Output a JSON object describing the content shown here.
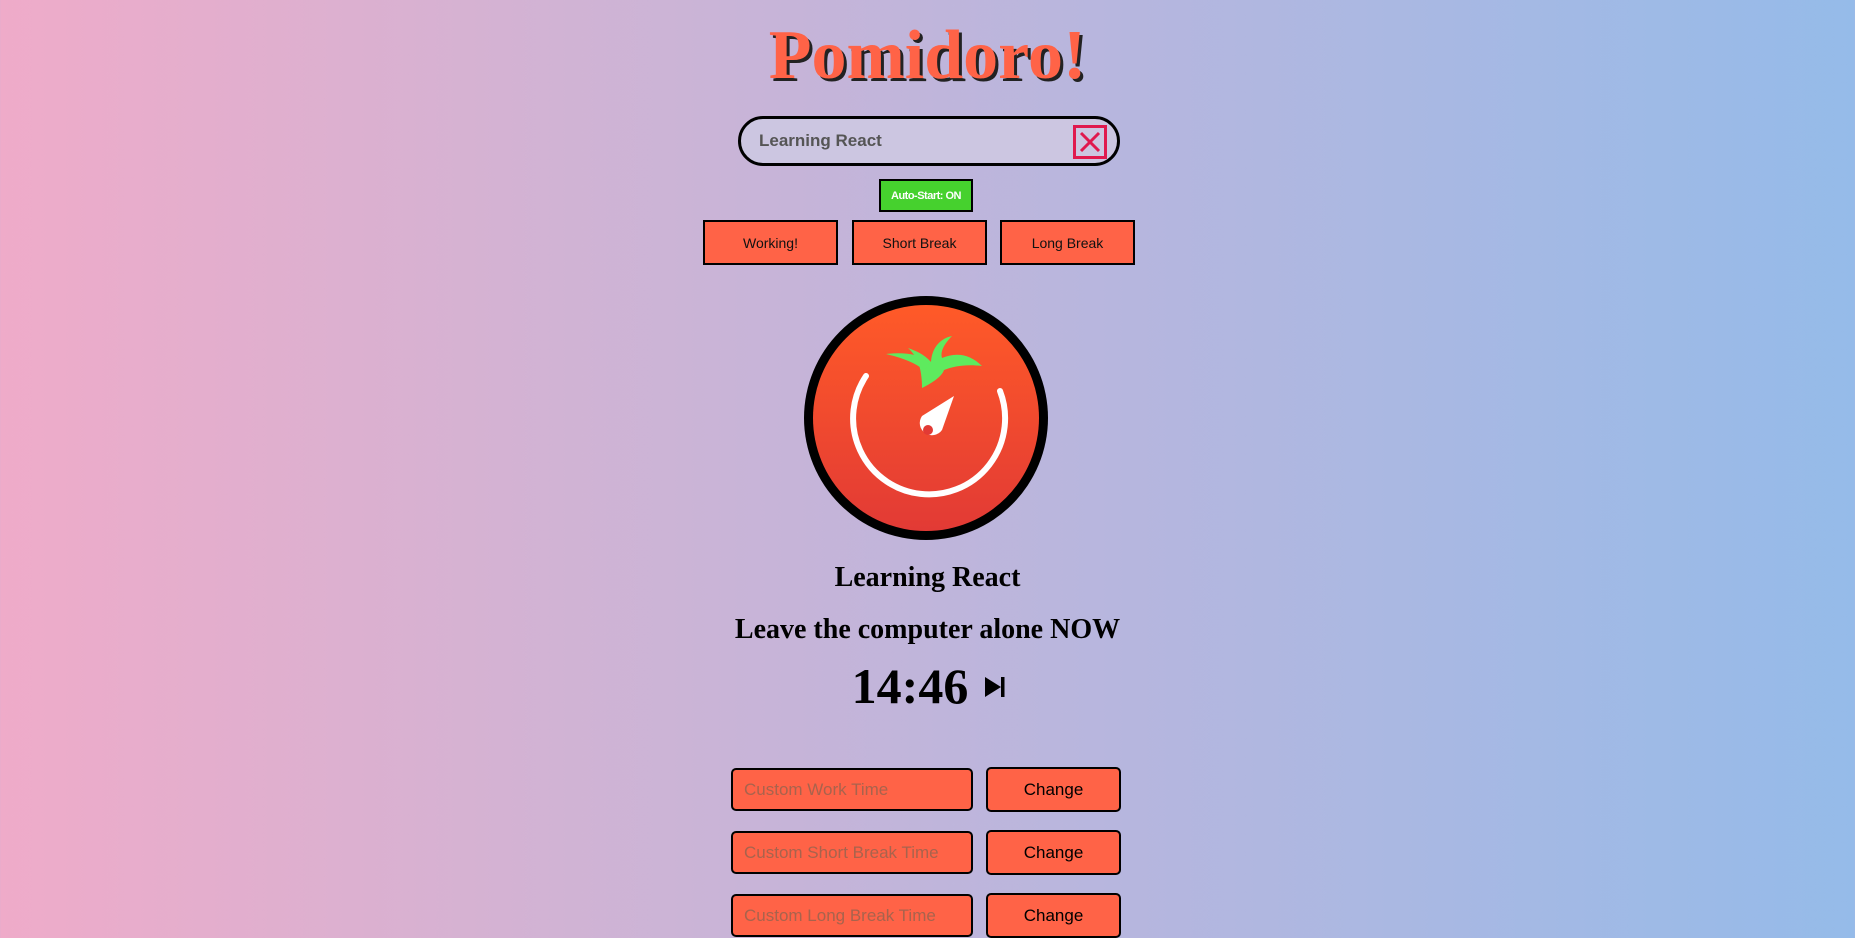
{
  "app": {
    "title": "Pomidoro!"
  },
  "task": {
    "input_value": "Learning React",
    "clear_icon": "close-box-icon"
  },
  "auto_start": {
    "label": "Auto-Start: ON",
    "color": "#46d12e"
  },
  "modes": [
    {
      "label": "Working!"
    },
    {
      "label": "Short Break"
    },
    {
      "label": "Long Break"
    }
  ],
  "logo": {
    "icon": "tomato-timer-icon",
    "colors": {
      "tomato": "#f04a2e",
      "leaf": "#5eea5e"
    }
  },
  "session": {
    "task_name": "Learning React",
    "message": "Leave the computer alone NOW",
    "time": "14:46",
    "skip_icon": "skip-next-icon"
  },
  "custom": [
    {
      "placeholder": "Custom Work Time",
      "button": "Change"
    },
    {
      "placeholder": "Custom Short Break Time",
      "button": "Change"
    },
    {
      "placeholder": "Custom Long Break Time",
      "button": "Change"
    }
  ],
  "colors": {
    "accent": "#ff6347",
    "clear_red": "#e0194e"
  }
}
